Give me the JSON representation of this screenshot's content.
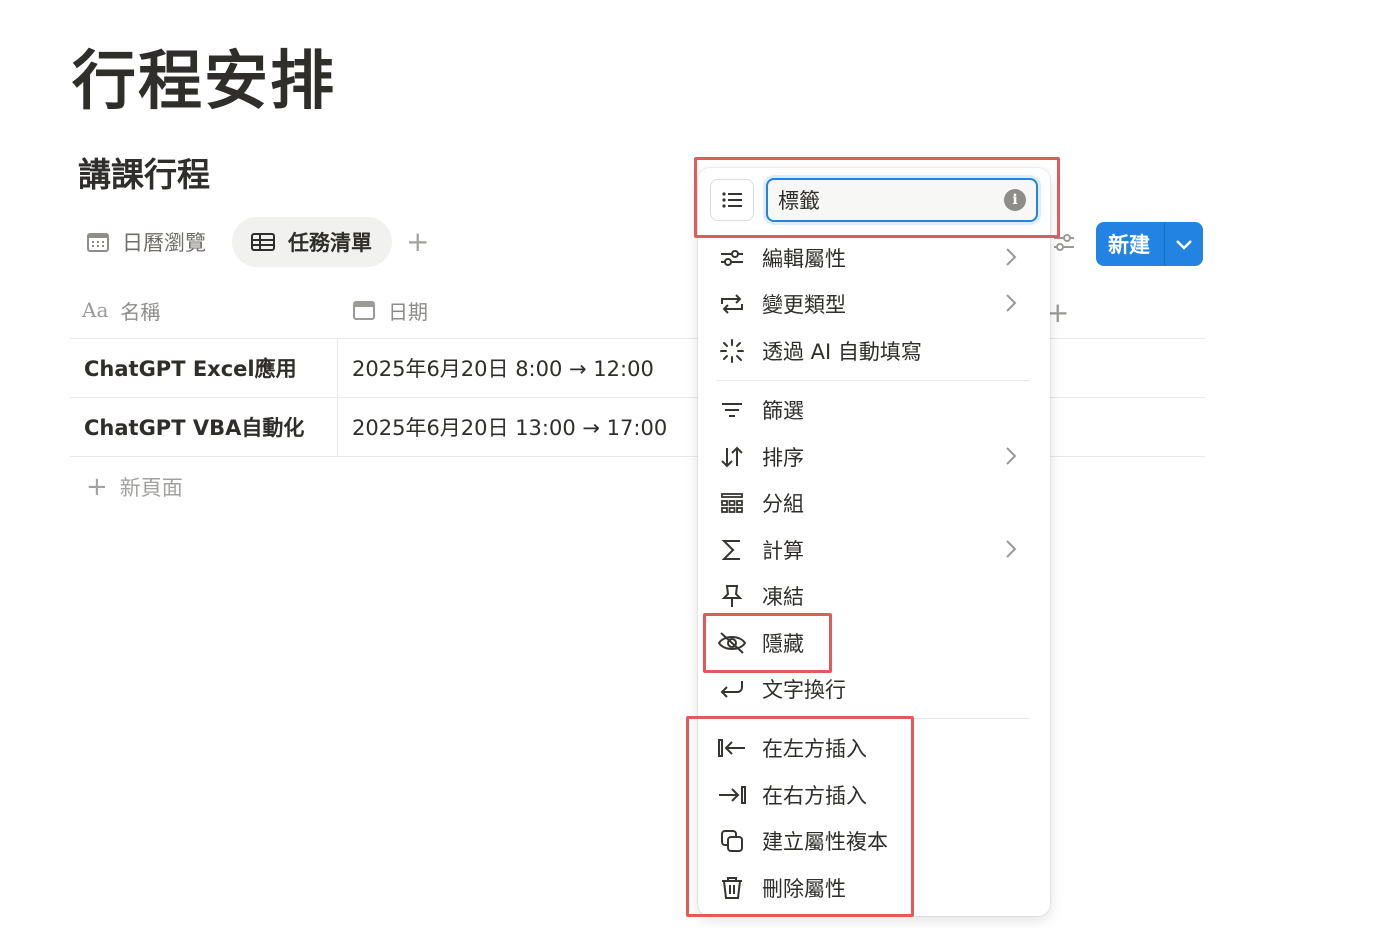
{
  "page": {
    "title": "行程安排"
  },
  "database": {
    "title": "講課行程"
  },
  "views": {
    "tabs": [
      {
        "label": "日曆瀏覽",
        "icon": "calendar-icon"
      },
      {
        "label": "任務清單",
        "icon": "table-icon"
      }
    ],
    "add_icon": "plus-icon"
  },
  "toolbar": {
    "new_label": "新建",
    "filter_icon": "sliders-icon",
    "dropdown_icon": "chevron-down-icon"
  },
  "table": {
    "columns": [
      {
        "label": "名稱",
        "icon": "text-aa-icon"
      },
      {
        "label": "日期",
        "icon": "calendar-icon"
      }
    ],
    "rows": [
      {
        "name": "ChatGPT Excel應用",
        "date": "2025年6月20日 8:00 → 12:00"
      },
      {
        "name": "ChatGPT VBA自動化",
        "date": "2025年6月20日 13:00 → 17:00"
      }
    ],
    "new_page_label": "新頁面"
  },
  "menu": {
    "property_name": "標籤",
    "items": [
      {
        "label": "編輯屬性",
        "icon": "sliders-icon",
        "submenu": true
      },
      {
        "label": "變更類型",
        "icon": "swap-icon",
        "submenu": true
      },
      {
        "label": "透過 AI 自動填寫",
        "icon": "sparkle-icon",
        "submenu": false
      },
      {
        "label": "篩選",
        "icon": "filter-icon",
        "submenu": false
      },
      {
        "label": "排序",
        "icon": "sort-icon",
        "submenu": true
      },
      {
        "label": "分組",
        "icon": "group-icon",
        "submenu": false
      },
      {
        "label": "計算",
        "icon": "sigma-icon",
        "submenu": true
      },
      {
        "label": "凍結",
        "icon": "pin-icon",
        "submenu": false
      },
      {
        "label": "隱藏",
        "icon": "eye-off-icon",
        "submenu": false
      },
      {
        "label": "文字換行",
        "icon": "wrap-icon",
        "submenu": false
      },
      {
        "label": "在左方插入",
        "icon": "insert-left-icon",
        "submenu": false
      },
      {
        "label": "在右方插入",
        "icon": "insert-right-icon",
        "submenu": false
      },
      {
        "label": "建立屬性複本",
        "icon": "duplicate-icon",
        "submenu": false
      },
      {
        "label": "刪除屬性",
        "icon": "trash-icon",
        "submenu": false
      }
    ]
  },
  "colors": {
    "accent": "#2383e2",
    "highlight": "#e15b5b",
    "text": "#2f2e2a",
    "muted": "#8e8d89"
  }
}
